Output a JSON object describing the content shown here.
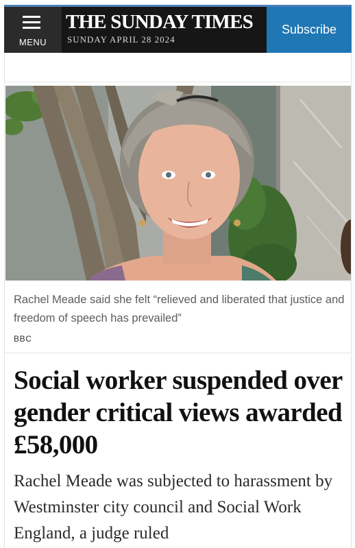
{
  "header": {
    "menu_label": "MENU",
    "masthead_title": "THE SUNDAY TIMES",
    "date": "SUNDAY APRIL 28 2024",
    "subscribe_label": "Subscribe"
  },
  "photo": {
    "icon": "portrait-photo"
  },
  "article": {
    "caption": "Rachel Meade said she felt “relieved and liberated that justice and freedom of speech has prevailed”",
    "credit": "BBC",
    "headline": "Social worker suspended over gender critical views awarded £58,000",
    "standfirst": "Rachel Meade was subjected to harassment by Westminster city council and Social Work England, a judge ruled"
  },
  "colors": {
    "header_bg": "#1e1e1e",
    "subscribe_bg": "#1f77b3",
    "accent_top": "#4a7fb8"
  }
}
